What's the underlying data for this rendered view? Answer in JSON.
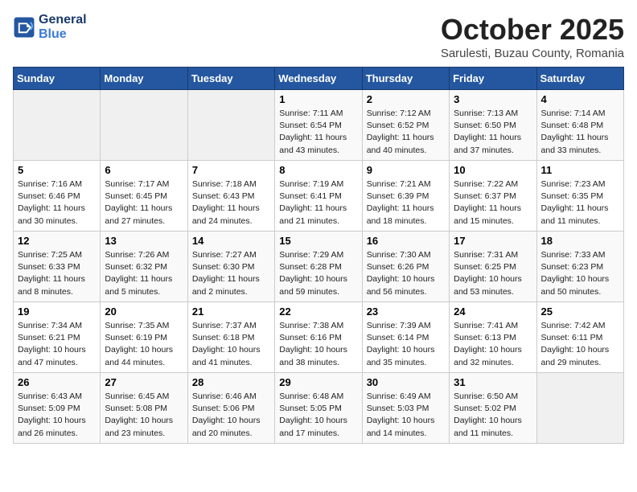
{
  "header": {
    "logo_line1": "General",
    "logo_line2": "Blue",
    "month": "October 2025",
    "location": "Sarulesti, Buzau County, Romania"
  },
  "weekdays": [
    "Sunday",
    "Monday",
    "Tuesday",
    "Wednesday",
    "Thursday",
    "Friday",
    "Saturday"
  ],
  "weeks": [
    [
      {
        "day": "",
        "info": ""
      },
      {
        "day": "",
        "info": ""
      },
      {
        "day": "",
        "info": ""
      },
      {
        "day": "1",
        "info": "Sunrise: 7:11 AM\nSunset: 6:54 PM\nDaylight: 11 hours and 43 minutes."
      },
      {
        "day": "2",
        "info": "Sunrise: 7:12 AM\nSunset: 6:52 PM\nDaylight: 11 hours and 40 minutes."
      },
      {
        "day": "3",
        "info": "Sunrise: 7:13 AM\nSunset: 6:50 PM\nDaylight: 11 hours and 37 minutes."
      },
      {
        "day": "4",
        "info": "Sunrise: 7:14 AM\nSunset: 6:48 PM\nDaylight: 11 hours and 33 minutes."
      }
    ],
    [
      {
        "day": "5",
        "info": "Sunrise: 7:16 AM\nSunset: 6:46 PM\nDaylight: 11 hours and 30 minutes."
      },
      {
        "day": "6",
        "info": "Sunrise: 7:17 AM\nSunset: 6:45 PM\nDaylight: 11 hours and 27 minutes."
      },
      {
        "day": "7",
        "info": "Sunrise: 7:18 AM\nSunset: 6:43 PM\nDaylight: 11 hours and 24 minutes."
      },
      {
        "day": "8",
        "info": "Sunrise: 7:19 AM\nSunset: 6:41 PM\nDaylight: 11 hours and 21 minutes."
      },
      {
        "day": "9",
        "info": "Sunrise: 7:21 AM\nSunset: 6:39 PM\nDaylight: 11 hours and 18 minutes."
      },
      {
        "day": "10",
        "info": "Sunrise: 7:22 AM\nSunset: 6:37 PM\nDaylight: 11 hours and 15 minutes."
      },
      {
        "day": "11",
        "info": "Sunrise: 7:23 AM\nSunset: 6:35 PM\nDaylight: 11 hours and 11 minutes."
      }
    ],
    [
      {
        "day": "12",
        "info": "Sunrise: 7:25 AM\nSunset: 6:33 PM\nDaylight: 11 hours and 8 minutes."
      },
      {
        "day": "13",
        "info": "Sunrise: 7:26 AM\nSunset: 6:32 PM\nDaylight: 11 hours and 5 minutes."
      },
      {
        "day": "14",
        "info": "Sunrise: 7:27 AM\nSunset: 6:30 PM\nDaylight: 11 hours and 2 minutes."
      },
      {
        "day": "15",
        "info": "Sunrise: 7:29 AM\nSunset: 6:28 PM\nDaylight: 10 hours and 59 minutes."
      },
      {
        "day": "16",
        "info": "Sunrise: 7:30 AM\nSunset: 6:26 PM\nDaylight: 10 hours and 56 minutes."
      },
      {
        "day": "17",
        "info": "Sunrise: 7:31 AM\nSunset: 6:25 PM\nDaylight: 10 hours and 53 minutes."
      },
      {
        "day": "18",
        "info": "Sunrise: 7:33 AM\nSunset: 6:23 PM\nDaylight: 10 hours and 50 minutes."
      }
    ],
    [
      {
        "day": "19",
        "info": "Sunrise: 7:34 AM\nSunset: 6:21 PM\nDaylight: 10 hours and 47 minutes."
      },
      {
        "day": "20",
        "info": "Sunrise: 7:35 AM\nSunset: 6:19 PM\nDaylight: 10 hours and 44 minutes."
      },
      {
        "day": "21",
        "info": "Sunrise: 7:37 AM\nSunset: 6:18 PM\nDaylight: 10 hours and 41 minutes."
      },
      {
        "day": "22",
        "info": "Sunrise: 7:38 AM\nSunset: 6:16 PM\nDaylight: 10 hours and 38 minutes."
      },
      {
        "day": "23",
        "info": "Sunrise: 7:39 AM\nSunset: 6:14 PM\nDaylight: 10 hours and 35 minutes."
      },
      {
        "day": "24",
        "info": "Sunrise: 7:41 AM\nSunset: 6:13 PM\nDaylight: 10 hours and 32 minutes."
      },
      {
        "day": "25",
        "info": "Sunrise: 7:42 AM\nSunset: 6:11 PM\nDaylight: 10 hours and 29 minutes."
      }
    ],
    [
      {
        "day": "26",
        "info": "Sunrise: 6:43 AM\nSunset: 5:09 PM\nDaylight: 10 hours and 26 minutes."
      },
      {
        "day": "27",
        "info": "Sunrise: 6:45 AM\nSunset: 5:08 PM\nDaylight: 10 hours and 23 minutes."
      },
      {
        "day": "28",
        "info": "Sunrise: 6:46 AM\nSunset: 5:06 PM\nDaylight: 10 hours and 20 minutes."
      },
      {
        "day": "29",
        "info": "Sunrise: 6:48 AM\nSunset: 5:05 PM\nDaylight: 10 hours and 17 minutes."
      },
      {
        "day": "30",
        "info": "Sunrise: 6:49 AM\nSunset: 5:03 PM\nDaylight: 10 hours and 14 minutes."
      },
      {
        "day": "31",
        "info": "Sunrise: 6:50 AM\nSunset: 5:02 PM\nDaylight: 10 hours and 11 minutes."
      },
      {
        "day": "",
        "info": ""
      }
    ]
  ]
}
